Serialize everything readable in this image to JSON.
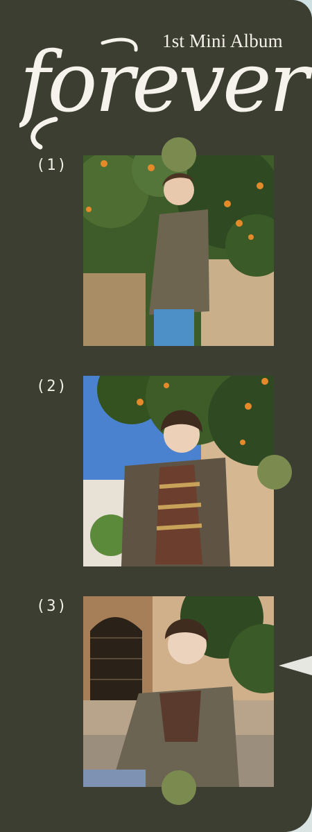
{
  "header": {
    "subtitle": "1st Mini Album",
    "script_title": "forever"
  },
  "photos": [
    {
      "number": "(1)"
    },
    {
      "number": "(2)"
    },
    {
      "number": "(3)"
    }
  ],
  "colors": {
    "panel": "#3b3e30",
    "accent_dot": "#7b8b50",
    "text": "#f4f1ea",
    "backdrop": "#d9e4e3"
  }
}
